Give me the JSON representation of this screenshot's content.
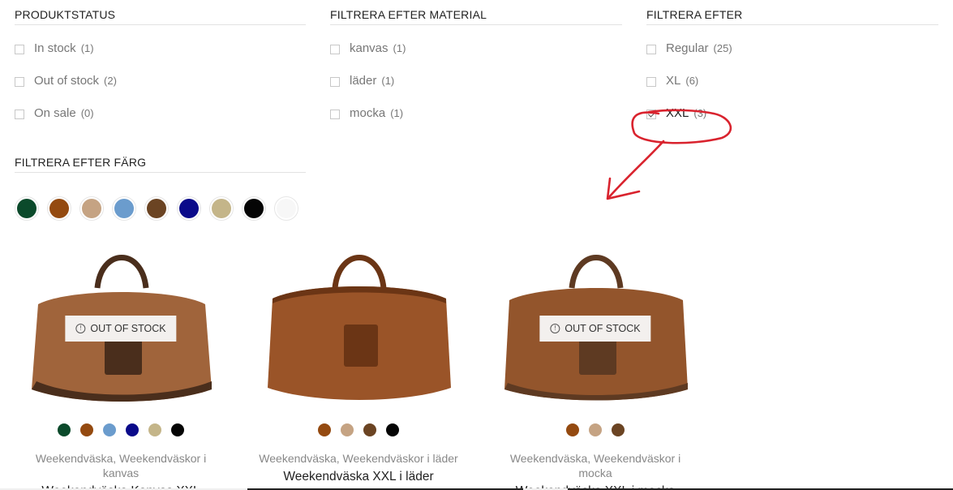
{
  "filters": {
    "status": {
      "title": "PRODUKTSTATUS",
      "items": [
        {
          "label": "In stock",
          "count": "(1)"
        },
        {
          "label": "Out of stock",
          "count": "(2)"
        },
        {
          "label": "On sale",
          "count": "(0)"
        }
      ]
    },
    "material": {
      "title": "FILTRERA EFTER MATERIAL",
      "items": [
        {
          "label": "kanvas",
          "count": "(1)"
        },
        {
          "label": "läder",
          "count": "(1)"
        },
        {
          "label": "mocka",
          "count": "(1)"
        }
      ]
    },
    "size": {
      "title": "FILTRERA EFTER",
      "items": [
        {
          "label": "Regular",
          "count": "(25)"
        },
        {
          "label": "XL",
          "count": "(6)"
        },
        {
          "label": "XXL",
          "count": "(3)",
          "checked": true
        }
      ]
    },
    "color": {
      "title": "FILTRERA EFTER FÄRG",
      "swatches": [
        "#0b4a2b",
        "#944a10",
        "#c5a383",
        "#6b9ccd",
        "#6b4423",
        "#0a0a8a",
        "#c4b589",
        "#050505",
        "#f7f7f7"
      ]
    }
  },
  "annotation_color": "#d9232e",
  "products": [
    {
      "badge": "OUT OF STOCK",
      "colors": [
        "#0b4a2b",
        "#944a10",
        "#6b9ccd",
        "#0a0a8a",
        "#c4b589",
        "#050505"
      ],
      "category": "Weekendväska, Weekendväskor i kanvas",
      "name": "Weekendväska Kanvas XXL",
      "bag_color": "#a0643b",
      "bag_dark": "#4a2e1c"
    },
    {
      "colors": [
        "#944a10",
        "#c5a383",
        "#6b4423",
        "#050505"
      ],
      "category": "Weekendväska, Weekendväskor i läder",
      "name": "Weekendväska XXL i läder",
      "bag_color": "#9a5428",
      "bag_dark": "#6b3515"
    },
    {
      "badge": "OUT OF STOCK",
      "colors": [
        "#944a10",
        "#c5a383",
        "#6b4423"
      ],
      "category": "Weekendväska, Weekendväskor i mocka",
      "name": "Weekendväska XXL i mocka",
      "bag_color": "#93552c",
      "bag_dark": "#5e3a22"
    }
  ]
}
